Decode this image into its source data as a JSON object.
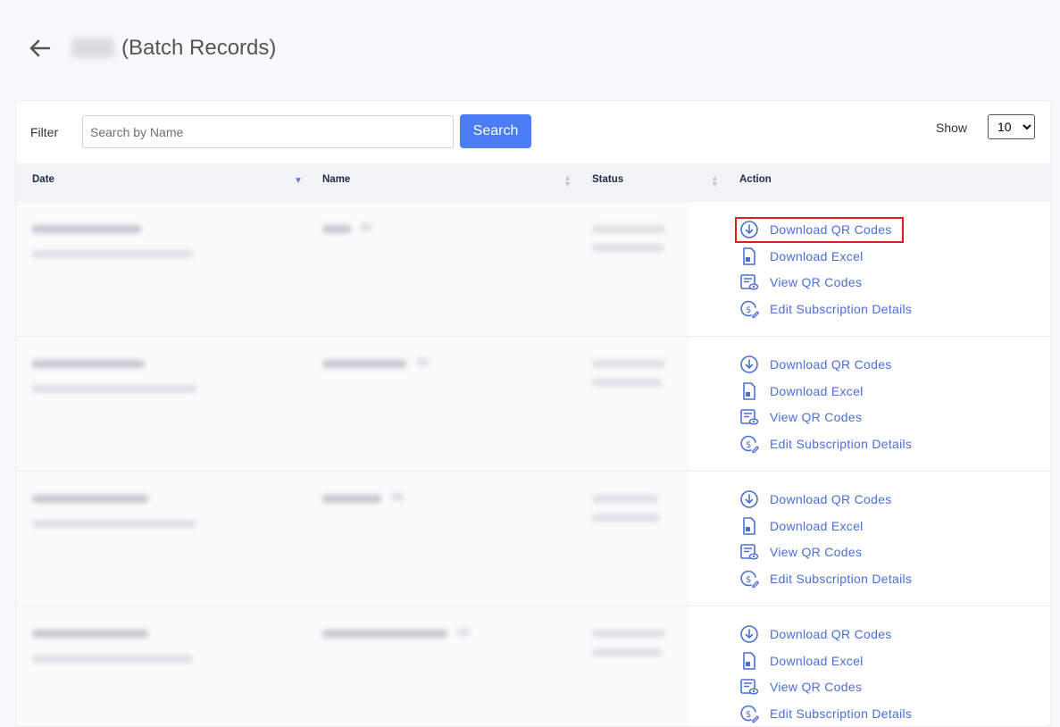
{
  "header": {
    "title": "(Batch Records)"
  },
  "filter": {
    "label": "Filter",
    "placeholder": "Search by Name",
    "search_button": "Search"
  },
  "show": {
    "label": "Show",
    "selected": "10"
  },
  "table": {
    "columns": [
      "Date",
      "Name",
      "Status",
      "Action"
    ]
  },
  "actions": {
    "download_qr": "Download QR Codes",
    "download_excel": "Download Excel",
    "view_qr": "View QR Codes",
    "edit_subscription": "Edit Subscription Details"
  },
  "colors": {
    "accent": "#4c7cf6",
    "link": "#4b6fd6",
    "highlight": "#e01e1e"
  }
}
